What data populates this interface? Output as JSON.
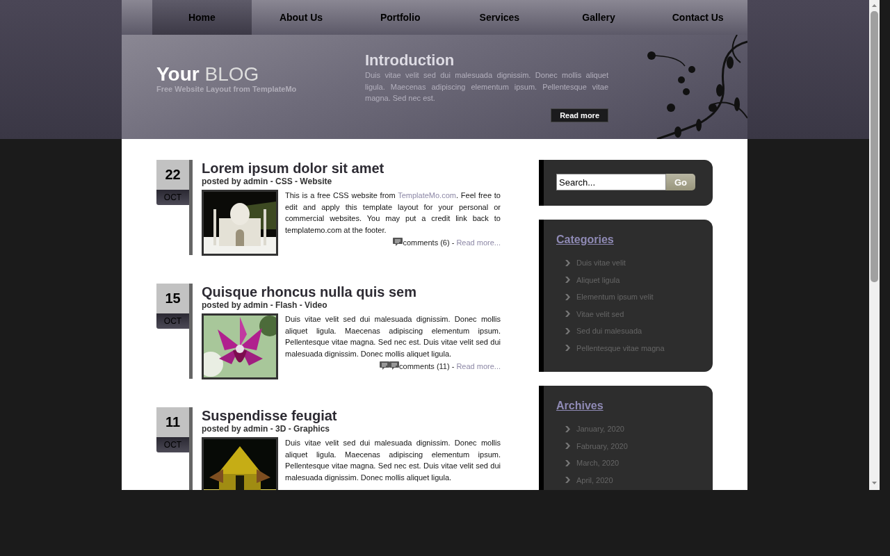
{
  "nav": [
    {
      "label": "Home",
      "selected": true
    },
    {
      "label": "About Us",
      "selected": false
    },
    {
      "label": "Portfolio",
      "selected": false
    },
    {
      "label": "Services",
      "selected": false
    },
    {
      "label": "Gallery",
      "selected": false
    },
    {
      "label": "Contact Us",
      "selected": false
    }
  ],
  "header": {
    "title_bold": "Your",
    "title_light": "BLOG",
    "tagline": "Free Website Layout from TemplateMo"
  },
  "intro": {
    "title": "Introduction",
    "text": "Duis vitae velit sed dui malesuada dignissim. Donec mollis aliquet ligula. Maecenas adipiscing elementum ipsum. Pellentesque vitae magna. Sed nec est.",
    "button": "Read more"
  },
  "posts": [
    {
      "day": "22",
      "month": "OCT",
      "title": "Lorem ipsum dolor sit amet",
      "meta": "posted by admin - CSS - Website",
      "text_before": "This is a free CSS website from ",
      "link": "TemplateMo.com",
      "text_after": ". Feel free to edit and apply this template layout for your personal or commercial websites. You may put a credit link back to templatemo.com at the footer.",
      "double_icon": false,
      "comments": "comments (6) - ",
      "read_more": "Read more..."
    },
    {
      "day": "15",
      "month": "OCT",
      "title": "Quisque rhoncus nulla quis sem",
      "meta": "posted by admin - Flash - Video",
      "text_before": "Duis vitae velit sed dui malesuada dignissim. Donec mollis aliquet ligula. Maecenas adipiscing elementum ipsum. Pellentesque vitae magna. Sed nec est. Duis vitae velit sed dui malesuada dignissim. Donec mollis aliquet ligula.",
      "double_icon": true,
      "comments": "comments (11) - ",
      "read_more": "Read more..."
    },
    {
      "day": "11",
      "month": "OCT",
      "title": "Suspendisse feugiat",
      "meta": "posted by admin - 3D - Graphics",
      "text_before": "Duis vitae velit sed dui malesuada dignissim. Donec mollis aliquet ligula. Maecenas adipiscing elementum ipsum. Pellentesque vitae magna. Sed nec est. Duis vitae velit sed dui malesuada dignissim. Donec mollis aliquet ligula."
    }
  ],
  "search": {
    "value": "Search...",
    "button": "Go"
  },
  "sidebar": [
    {
      "title": "Categories",
      "items": [
        "Duis vitae velit",
        "Aliquet ligula",
        "Elementum ipsum velit",
        "Vitae velit sed",
        "Sed dui malesuada",
        "Pellentesque vitae magna"
      ]
    },
    {
      "title": "Archives",
      "items": [
        "January, 2020",
        "Fabruary, 2020",
        "March, 2020",
        "April, 2020"
      ]
    }
  ]
}
